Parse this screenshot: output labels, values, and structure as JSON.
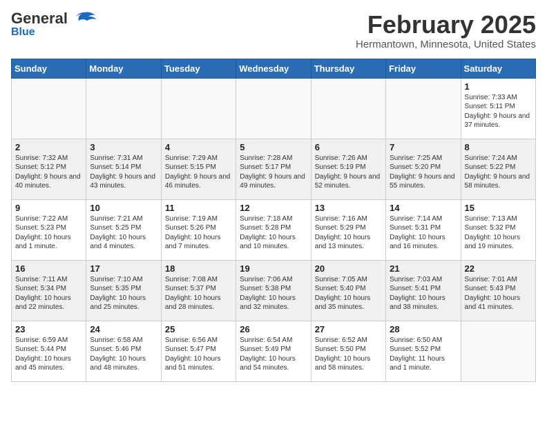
{
  "header": {
    "logo_general": "General",
    "logo_blue": "Blue",
    "month_title": "February 2025",
    "location": "Hermantown, Minnesota, United States"
  },
  "days_of_week": [
    "Sunday",
    "Monday",
    "Tuesday",
    "Wednesday",
    "Thursday",
    "Friday",
    "Saturday"
  ],
  "weeks": [
    {
      "shade": false,
      "days": [
        {
          "num": "",
          "info": ""
        },
        {
          "num": "",
          "info": ""
        },
        {
          "num": "",
          "info": ""
        },
        {
          "num": "",
          "info": ""
        },
        {
          "num": "",
          "info": ""
        },
        {
          "num": "",
          "info": ""
        },
        {
          "num": "1",
          "info": "Sunrise: 7:33 AM\nSunset: 5:11 PM\nDaylight: 9 hours and 37 minutes."
        }
      ]
    },
    {
      "shade": true,
      "days": [
        {
          "num": "2",
          "info": "Sunrise: 7:32 AM\nSunset: 5:12 PM\nDaylight: 9 hours and 40 minutes."
        },
        {
          "num": "3",
          "info": "Sunrise: 7:31 AM\nSunset: 5:14 PM\nDaylight: 9 hours and 43 minutes."
        },
        {
          "num": "4",
          "info": "Sunrise: 7:29 AM\nSunset: 5:15 PM\nDaylight: 9 hours and 46 minutes."
        },
        {
          "num": "5",
          "info": "Sunrise: 7:28 AM\nSunset: 5:17 PM\nDaylight: 9 hours and 49 minutes."
        },
        {
          "num": "6",
          "info": "Sunrise: 7:26 AM\nSunset: 5:19 PM\nDaylight: 9 hours and 52 minutes."
        },
        {
          "num": "7",
          "info": "Sunrise: 7:25 AM\nSunset: 5:20 PM\nDaylight: 9 hours and 55 minutes."
        },
        {
          "num": "8",
          "info": "Sunrise: 7:24 AM\nSunset: 5:22 PM\nDaylight: 9 hours and 58 minutes."
        }
      ]
    },
    {
      "shade": false,
      "days": [
        {
          "num": "9",
          "info": "Sunrise: 7:22 AM\nSunset: 5:23 PM\nDaylight: 10 hours and 1 minute."
        },
        {
          "num": "10",
          "info": "Sunrise: 7:21 AM\nSunset: 5:25 PM\nDaylight: 10 hours and 4 minutes."
        },
        {
          "num": "11",
          "info": "Sunrise: 7:19 AM\nSunset: 5:26 PM\nDaylight: 10 hours and 7 minutes."
        },
        {
          "num": "12",
          "info": "Sunrise: 7:18 AM\nSunset: 5:28 PM\nDaylight: 10 hours and 10 minutes."
        },
        {
          "num": "13",
          "info": "Sunrise: 7:16 AM\nSunset: 5:29 PM\nDaylight: 10 hours and 13 minutes."
        },
        {
          "num": "14",
          "info": "Sunrise: 7:14 AM\nSunset: 5:31 PM\nDaylight: 10 hours and 16 minutes."
        },
        {
          "num": "15",
          "info": "Sunrise: 7:13 AM\nSunset: 5:32 PM\nDaylight: 10 hours and 19 minutes."
        }
      ]
    },
    {
      "shade": true,
      "days": [
        {
          "num": "16",
          "info": "Sunrise: 7:11 AM\nSunset: 5:34 PM\nDaylight: 10 hours and 22 minutes."
        },
        {
          "num": "17",
          "info": "Sunrise: 7:10 AM\nSunset: 5:35 PM\nDaylight: 10 hours and 25 minutes."
        },
        {
          "num": "18",
          "info": "Sunrise: 7:08 AM\nSunset: 5:37 PM\nDaylight: 10 hours and 28 minutes."
        },
        {
          "num": "19",
          "info": "Sunrise: 7:06 AM\nSunset: 5:38 PM\nDaylight: 10 hours and 32 minutes."
        },
        {
          "num": "20",
          "info": "Sunrise: 7:05 AM\nSunset: 5:40 PM\nDaylight: 10 hours and 35 minutes."
        },
        {
          "num": "21",
          "info": "Sunrise: 7:03 AM\nSunset: 5:41 PM\nDaylight: 10 hours and 38 minutes."
        },
        {
          "num": "22",
          "info": "Sunrise: 7:01 AM\nSunset: 5:43 PM\nDaylight: 10 hours and 41 minutes."
        }
      ]
    },
    {
      "shade": false,
      "days": [
        {
          "num": "23",
          "info": "Sunrise: 6:59 AM\nSunset: 5:44 PM\nDaylight: 10 hours and 45 minutes."
        },
        {
          "num": "24",
          "info": "Sunrise: 6:58 AM\nSunset: 5:46 PM\nDaylight: 10 hours and 48 minutes."
        },
        {
          "num": "25",
          "info": "Sunrise: 6:56 AM\nSunset: 5:47 PM\nDaylight: 10 hours and 51 minutes."
        },
        {
          "num": "26",
          "info": "Sunrise: 6:54 AM\nSunset: 5:49 PM\nDaylight: 10 hours and 54 minutes."
        },
        {
          "num": "27",
          "info": "Sunrise: 6:52 AM\nSunset: 5:50 PM\nDaylight: 10 hours and 58 minutes."
        },
        {
          "num": "28",
          "info": "Sunrise: 6:50 AM\nSunset: 5:52 PM\nDaylight: 11 hours and 1 minute."
        },
        {
          "num": "",
          "info": ""
        }
      ]
    }
  ]
}
